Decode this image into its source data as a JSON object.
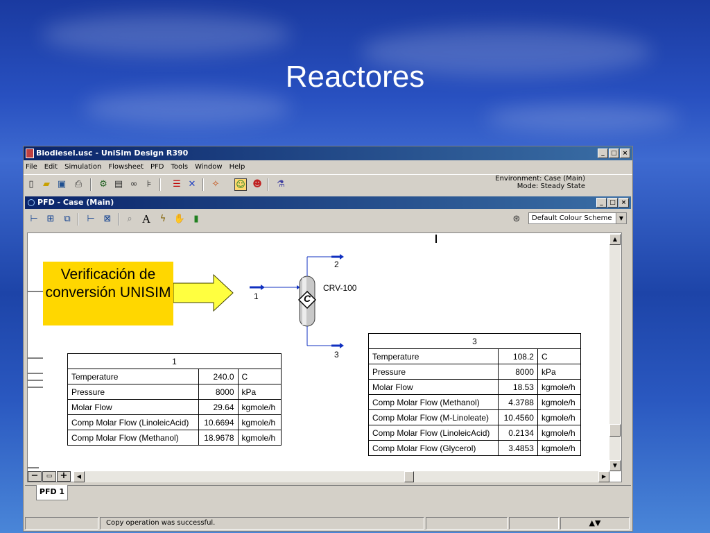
{
  "slide": {
    "title": "Reactores"
  },
  "window": {
    "title": "Biodiesel.usc - UniSim Design R390",
    "menu": [
      "File",
      "Edit",
      "Simulation",
      "Flowsheet",
      "PFD",
      "Tools",
      "Window",
      "Help"
    ],
    "environment": "Environment: Case (Main)",
    "mode": "Mode: Steady State"
  },
  "pfd_window": {
    "title": "PFD - Case (Main)",
    "colour_scheme": "Default Colour Scheme",
    "tab": "PFD 1"
  },
  "annotation": {
    "text": "Verificación de conversión UNISIM"
  },
  "reactor": {
    "name": "CRV-100",
    "symbol": "C"
  },
  "streams": {
    "feed": "1",
    "vapour": "2",
    "liquid": "3"
  },
  "table1": {
    "header": "1",
    "rows": [
      {
        "label": "Temperature",
        "value": "240.0",
        "unit": "C"
      },
      {
        "label": "Pressure",
        "value": "8000",
        "unit": "kPa"
      },
      {
        "label": "Molar Flow",
        "value": "29.64",
        "unit": "kgmole/h"
      },
      {
        "label": "Comp Molar Flow (LinoleicAcid)",
        "value": "10.6694",
        "unit": "kgmole/h"
      },
      {
        "label": "Comp Molar Flow (Methanol)",
        "value": "18.9678",
        "unit": "kgmole/h"
      }
    ]
  },
  "table3": {
    "header": "3",
    "rows": [
      {
        "label": "Temperature",
        "value": "108.2",
        "unit": "C"
      },
      {
        "label": "Pressure",
        "value": "8000",
        "unit": "kPa"
      },
      {
        "label": "Molar Flow",
        "value": "18.53",
        "unit": "kgmole/h"
      },
      {
        "label": "Comp Molar Flow (Methanol)",
        "value": "4.3788",
        "unit": "kgmole/h"
      },
      {
        "label": "Comp Molar Flow (M-Linoleate)",
        "value": "10.4560",
        "unit": "kgmole/h"
      },
      {
        "label": "Comp Molar Flow (LinoleicAcid)",
        "value": "0.2134",
        "unit": "kgmole/h"
      },
      {
        "label": "Comp Molar Flow (Glycerol)",
        "value": "3.4853",
        "unit": "kgmole/h"
      }
    ]
  },
  "status": {
    "message": "Copy operation was successful."
  }
}
